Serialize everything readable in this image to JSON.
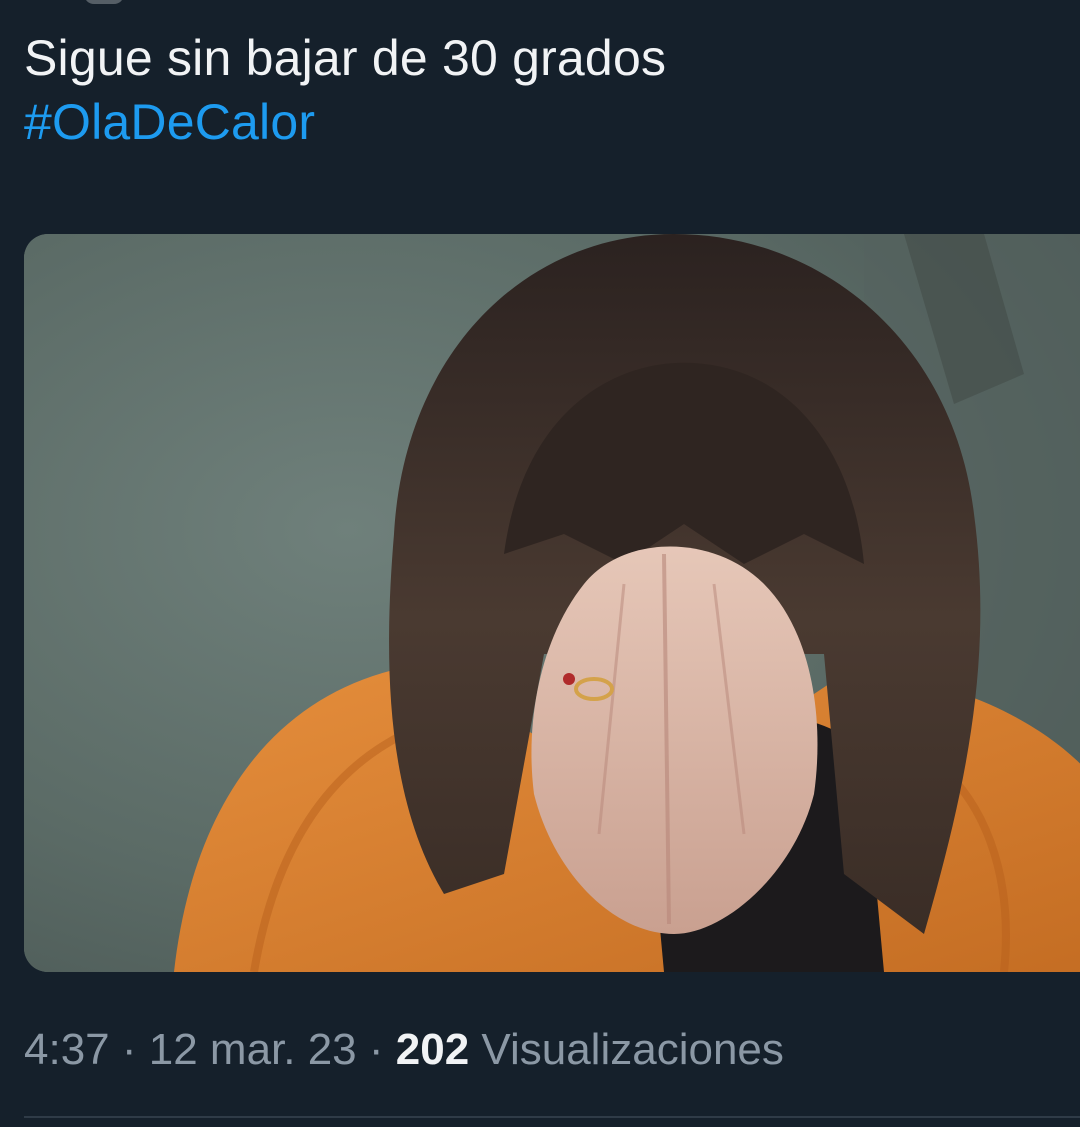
{
  "tweet": {
    "text_line1": "Sigue sin bajar de 30 grados",
    "hashtag": "#OlaDeCalor",
    "media": {
      "icon": "photo",
      "colors": {
        "background": "#5d6e69",
        "hair": "#3a2e28",
        "sweater": "#d9802f",
        "skin": "#d8b8a8"
      }
    },
    "meta": {
      "time": "4:37",
      "separator1": " · ",
      "date": "12 mar. 23",
      "separator2": " · ",
      "views_count": "202",
      "views_label": " Visualizaciones"
    }
  },
  "colors": {
    "background": "#15202b",
    "text": "#f1f3f5",
    "hashtag": "#1d9bf0",
    "meta": "#8b98a5",
    "divider": "#2f3b47"
  }
}
